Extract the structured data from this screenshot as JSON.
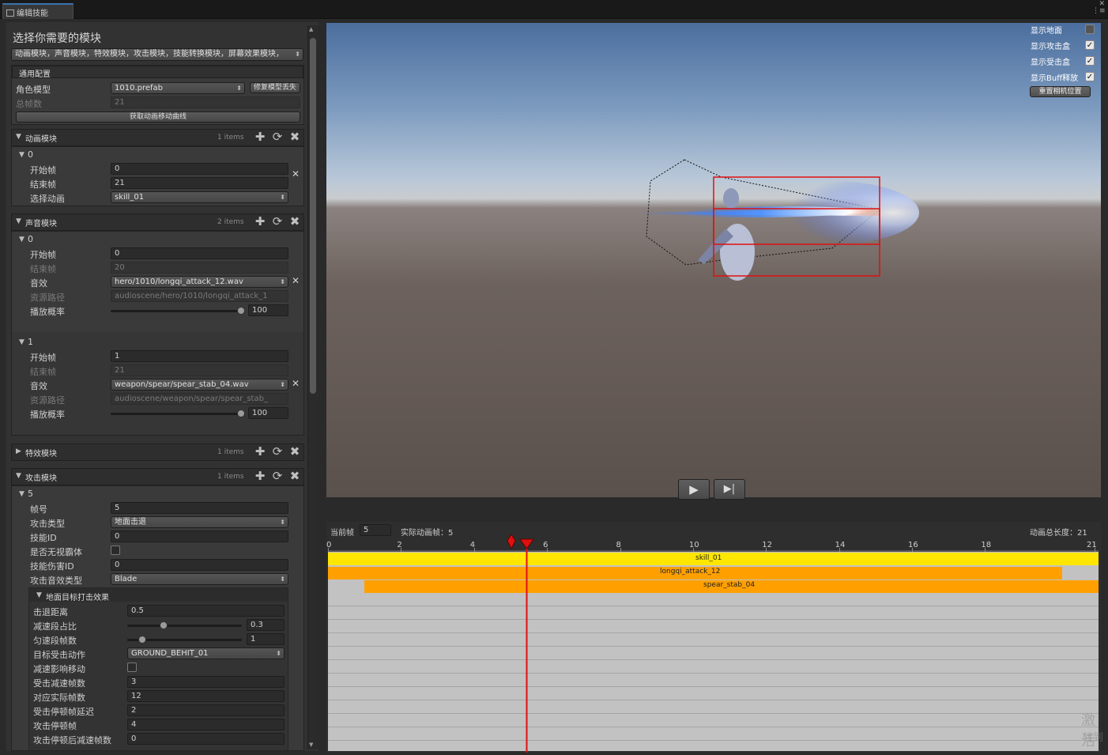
{
  "window": {
    "tab_title": "编辑技能",
    "tab_icon": "editor-window-icon",
    "menu_icon": "window-menu-icon",
    "close_glyph": "✕",
    "menu_glyph": "⋮≡"
  },
  "panel": {
    "title": "选择你需要的模块",
    "module_select": "动画模块，声音模块，特效模块，攻击模块，技能转换模块，屏幕效果模块，",
    "general": {
      "title": "通用配置",
      "model_label": "角色模型",
      "model_value": "1010.prefab",
      "fix_button": "修复模型丢失",
      "frames_label": "总帧数",
      "frames_value": "21",
      "get_curve_button": "获取动画移动曲线"
    },
    "anim_module": {
      "title": "动画模块",
      "count": "1 items",
      "index": "0",
      "start_label": "开始帧",
      "start": "0",
      "end_label": "结束帧",
      "end": "21",
      "select_label": "选择动画",
      "select": "skill_01"
    },
    "sound_module": {
      "title": "声音模块",
      "count": "2 items",
      "entries": [
        {
          "index": "0",
          "start_label": "开始帧",
          "start": "0",
          "end_label": "结束帧",
          "end": "20",
          "sfx_label": "音效",
          "sfx": "hero/1010/longqi_attack_12.wav",
          "path_label": "资源路径",
          "path": "audioscene/hero/1010/longqi_attack_1",
          "prob_label": "播放概率",
          "prob": "100",
          "prob_level": 1.0
        },
        {
          "index": "1",
          "start_label": "开始帧",
          "start": "1",
          "end_label": "结束帧",
          "end": "21",
          "sfx_label": "音效",
          "sfx": "weapon/spear/spear_stab_04.wav",
          "path_label": "资源路径",
          "path": "audioscene/weapon/spear/spear_stab_",
          "prob_label": "播放概率",
          "prob": "100",
          "prob_level": 1.0
        }
      ]
    },
    "fx_module": {
      "title": "特效模块",
      "count": "1 items"
    },
    "attack_module": {
      "title": "攻击模块",
      "count": "1 items",
      "index": "5",
      "fields": {
        "frame_label": "帧号",
        "frame": "5",
        "type_label": "攻击类型",
        "type": "地面击退",
        "skill_id_label": "技能ID",
        "skill_id": "0",
        "ignore_label": "是否无视霸体",
        "dmg_id_label": "技能伤害ID",
        "dmg_id": "0",
        "sfx_type_label": "攻击音效类型",
        "sfx_type": "Blade"
      },
      "ground": {
        "title": "地面目标打击效果",
        "knockback_label": "击退距离",
        "knockback": "0.5",
        "decel_ratio_label": "减速段占比",
        "decel_ratio": "0.3",
        "decel_ratio_level": 0.3,
        "uniform_label": "匀速段帧数",
        "uniform": "1",
        "uniform_level": 0.1,
        "hit_anim_label": "目标受击动作",
        "hit_anim": "GROUND_BEHIT_01",
        "decel_move_label": "减速影响移动",
        "hit_decel_label": "受击减速帧数",
        "hit_decel": "3",
        "real_frames_label": "对应实际帧数",
        "real_frames": "12",
        "hit_delay_label": "受击停顿帧延迟",
        "hit_delay": "2",
        "atk_pause_label": "攻击停顿帧",
        "atk_pause": "4",
        "after_pause_label": "攻击停顿后减速帧数",
        "after_pause": "0"
      }
    }
  },
  "viewport": {
    "toggles": [
      {
        "label": "显示地面",
        "checked": false
      },
      {
        "label": "显示攻击盒",
        "checked": true
      },
      {
        "label": "显示受击盒",
        "checked": true
      },
      {
        "label": "显示Buff释放",
        "checked": true
      }
    ],
    "reset_camera": "重置相机位置",
    "play_glyph": "▶",
    "step_glyph": "▶|",
    "hitbox_color": "#e01010"
  },
  "timeline": {
    "current_label": "当前帧",
    "current": "5",
    "actual_label": "实际动画帧：5",
    "total_label": "动画总长度：21",
    "ticks": [
      "0",
      "2",
      "4",
      "6",
      "8",
      "10",
      "12",
      "14",
      "16",
      "18",
      "21"
    ],
    "tracks": [
      "skill_01",
      "longqi_attack_12",
      "spear_stab_04"
    ],
    "colors": {
      "yellow": "#ffe600",
      "orange": "#ffa000",
      "playhead": "#e01010"
    }
  },
  "watermark": [
    "激活",
    "转到"
  ]
}
